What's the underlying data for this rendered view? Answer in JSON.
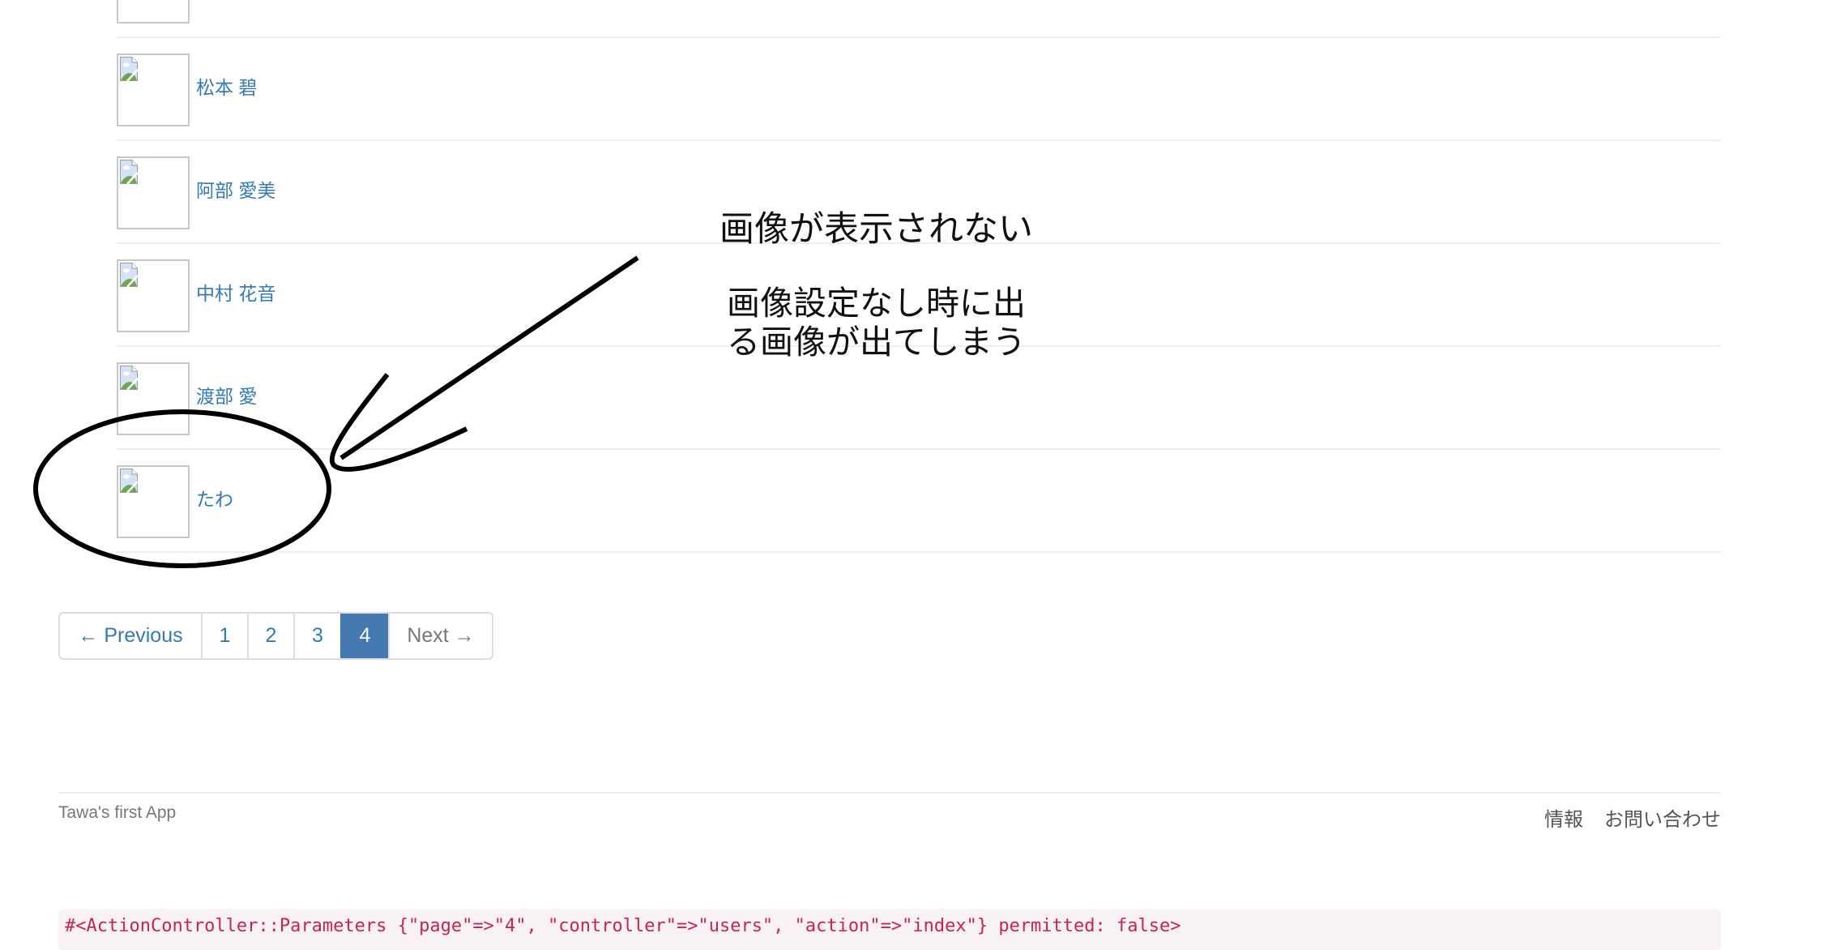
{
  "users": [
    {
      "name": ""
    },
    {
      "name": "松本 碧"
    },
    {
      "name": "阿部 愛美"
    },
    {
      "name": "中村 花音"
    },
    {
      "name": "渡部 愛"
    },
    {
      "name": "たわ"
    }
  ],
  "pagination": {
    "previous": "← Previous",
    "pages": [
      "1",
      "2",
      "3",
      "4"
    ],
    "current_page": "4",
    "next": "Next →"
  },
  "footer": {
    "brand": "Tawa's first App",
    "links": [
      "情報",
      "お問い合わせ"
    ]
  },
  "debug": {
    "params": "#<ActionController::Parameters {\"page\"=>\"4\", \"controller\"=>\"users\", \"action\"=>\"index\"} permitted: false>"
  },
  "annotations": {
    "title": "画像が表示されない",
    "note_line1": "画像設定なし時に出",
    "note_line2": "る画像が出てしまう"
  },
  "colors": {
    "link": "#337ab7",
    "active_page": "#4579b2",
    "code_text": "#c7254e",
    "code_bg": "#f9f2f4"
  }
}
